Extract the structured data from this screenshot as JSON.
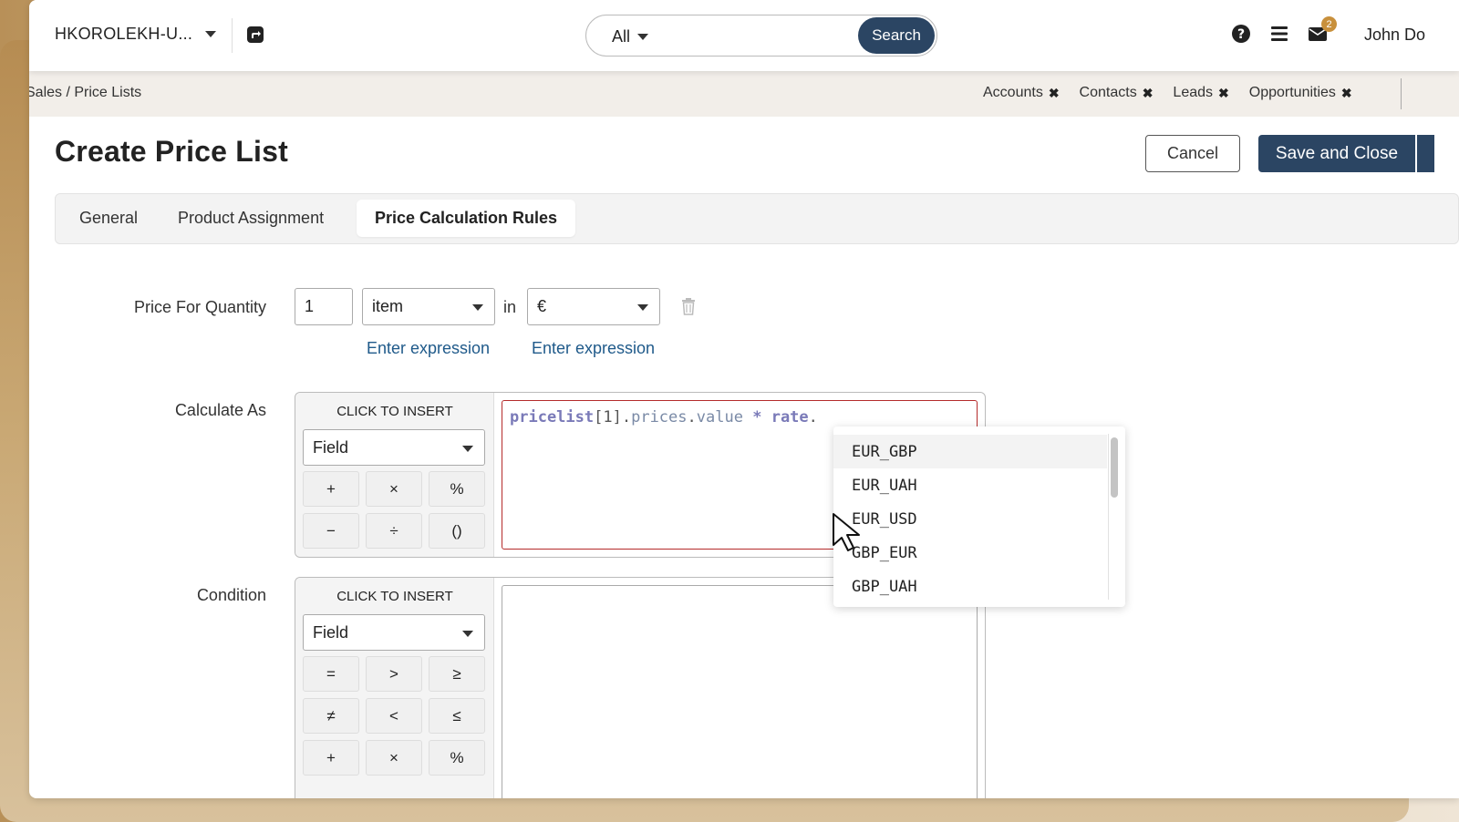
{
  "header": {
    "org_name": "HKOROLEKH-U...",
    "search": {
      "scope": "All",
      "placeholder": "",
      "button_label": "Search"
    },
    "mail_badge_count": "2",
    "user_name": "John Do"
  },
  "breadcrumb": "Sales / Price Lists",
  "pinned_tabs": [
    {
      "label": "Accounts"
    },
    {
      "label": "Contacts"
    },
    {
      "label": "Leads"
    },
    {
      "label": "Opportunities"
    }
  ],
  "page": {
    "title": "Create Price List",
    "cancel_label": "Cancel",
    "save_label": "Save and Close"
  },
  "tabs": [
    {
      "label": "General",
      "active": false
    },
    {
      "label": "Product Assignment",
      "active": false
    },
    {
      "label": "Price Calculation Rules",
      "active": true
    }
  ],
  "form": {
    "price_for_quantity": {
      "label": "Price For Quantity",
      "quantity": "1",
      "unit": "item",
      "in_word": "in",
      "currency": "€",
      "unit_expression_link": "Enter expression",
      "currency_expression_link": "Enter expression"
    },
    "calculate_as": {
      "label": "Calculate As",
      "insert_title": "CLICK TO INSERT",
      "field_select": "Field",
      "operators": [
        "+",
        "×",
        "%",
        "−",
        "÷",
        "()"
      ],
      "expression": {
        "var": "pricelist",
        "index": "[1]",
        "dot1": ".",
        "prop1": "prices",
        "dot2": ".",
        "prop2": "value",
        "op": "*",
        "rate": "rate",
        "dot3": "."
      }
    },
    "condition": {
      "label": "Condition",
      "insert_title": "CLICK TO INSERT",
      "field_select": "Field",
      "operators": [
        "=",
        ">",
        "≥",
        "≠",
        "<",
        "≤",
        "+",
        "×",
        "%"
      ],
      "expression": ""
    }
  },
  "autocomplete": {
    "items": [
      "EUR_GBP",
      "EUR_UAH",
      "EUR_USD",
      "GBP_EUR",
      "GBP_UAH"
    ],
    "highlighted_index": 0
  },
  "colors": {
    "primary": "#2b4563",
    "link": "#1f5a8a",
    "error_border": "#b52b2b",
    "badge": "#c8903c"
  }
}
